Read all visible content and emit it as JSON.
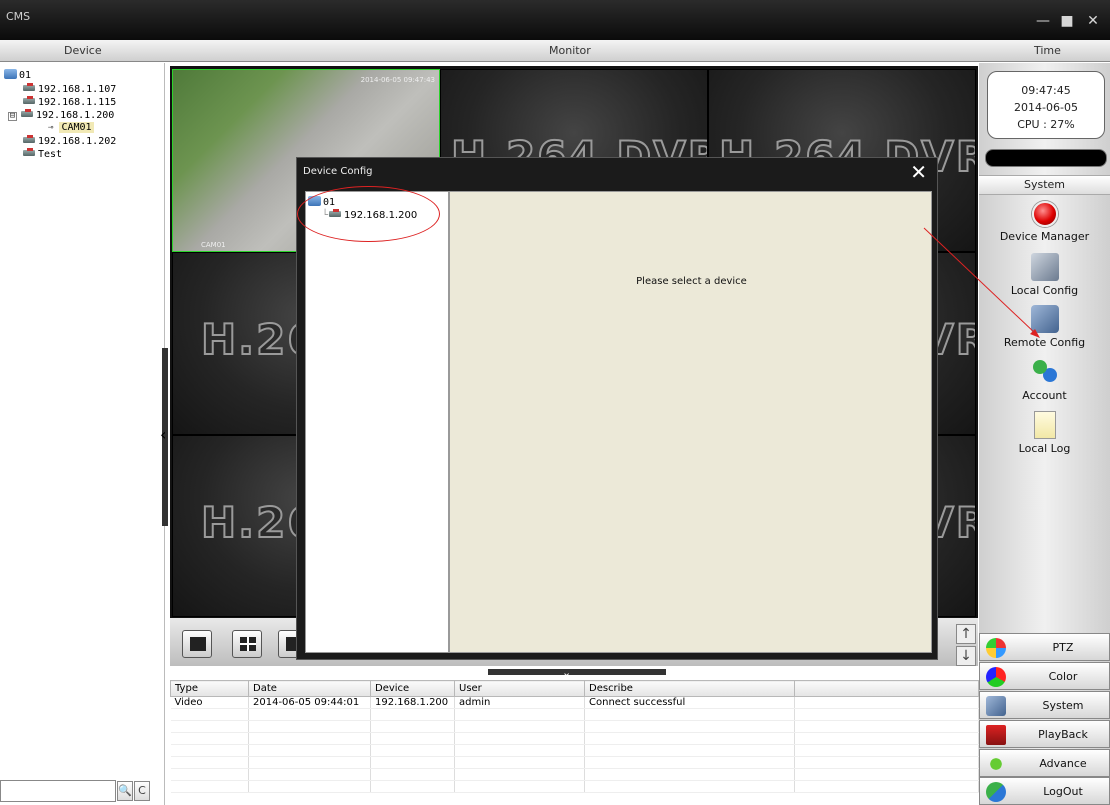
{
  "window": {
    "title": "CMS",
    "controls": [
      "—",
      "■",
      "✕"
    ]
  },
  "header": {
    "device": "Device",
    "monitor": "Monitor",
    "time": "Time"
  },
  "device_tree": {
    "root": "01",
    "items": [
      {
        "label": "192.168.1.107"
      },
      {
        "label": "192.168.1.115"
      },
      {
        "label": "192.168.1.200",
        "expanded_marker": "⊟"
      },
      {
        "label": "CAM01"
      },
      {
        "label": "192.168.1.202"
      },
      {
        "label": "Test"
      }
    ]
  },
  "search": {
    "value": "",
    "search_glyph": "🔍",
    "refresh_glyph": "C"
  },
  "monitor": {
    "logo": "H.264 DVR",
    "camera_stamp": "2014-06-05 09:47:43",
    "camera_name": "CAM01"
  },
  "dialog": {
    "title": "Device Config",
    "close": "✕",
    "tree_root": "01",
    "tree_device": "192.168.1.200",
    "message": "Please select a device"
  },
  "log": {
    "columns": [
      "Type",
      "Date",
      "Device",
      "User",
      "Describe",
      ""
    ],
    "rows": [
      [
        "Video",
        "2014-06-05 09:44:01",
        "192.168.1.200",
        "admin",
        "Connect successful",
        ""
      ]
    ]
  },
  "clock": {
    "time": "09:47:45",
    "date": "2014-06-05",
    "cpu": "CPU : 27%"
  },
  "system_panel": {
    "heading": "System",
    "items": [
      {
        "label": "Device Manager",
        "icon": "device-manager-icon"
      },
      {
        "label": "Local Config",
        "icon": "local-config-icon"
      },
      {
        "label": "Remote Config",
        "icon": "remote-config-icon"
      },
      {
        "label": "Account",
        "icon": "account-icon"
      },
      {
        "label": "Local Log",
        "icon": "local-log-icon"
      }
    ]
  },
  "bottom_buttons": [
    {
      "label": "PTZ",
      "icon": "ptz-icon"
    },
    {
      "label": "Color",
      "icon": "color-icon"
    },
    {
      "label": "System",
      "icon": "system-icon"
    },
    {
      "label": "PlayBack",
      "icon": "playback-icon"
    },
    {
      "label": "Advance",
      "icon": "advance-icon"
    },
    {
      "label": "LogOut",
      "icon": "logout-icon"
    }
  ],
  "colors": {
    "selected_cell_border": "#2bd42b",
    "annotation": "#dd2222",
    "dialog_bg": "#ece9d8"
  }
}
